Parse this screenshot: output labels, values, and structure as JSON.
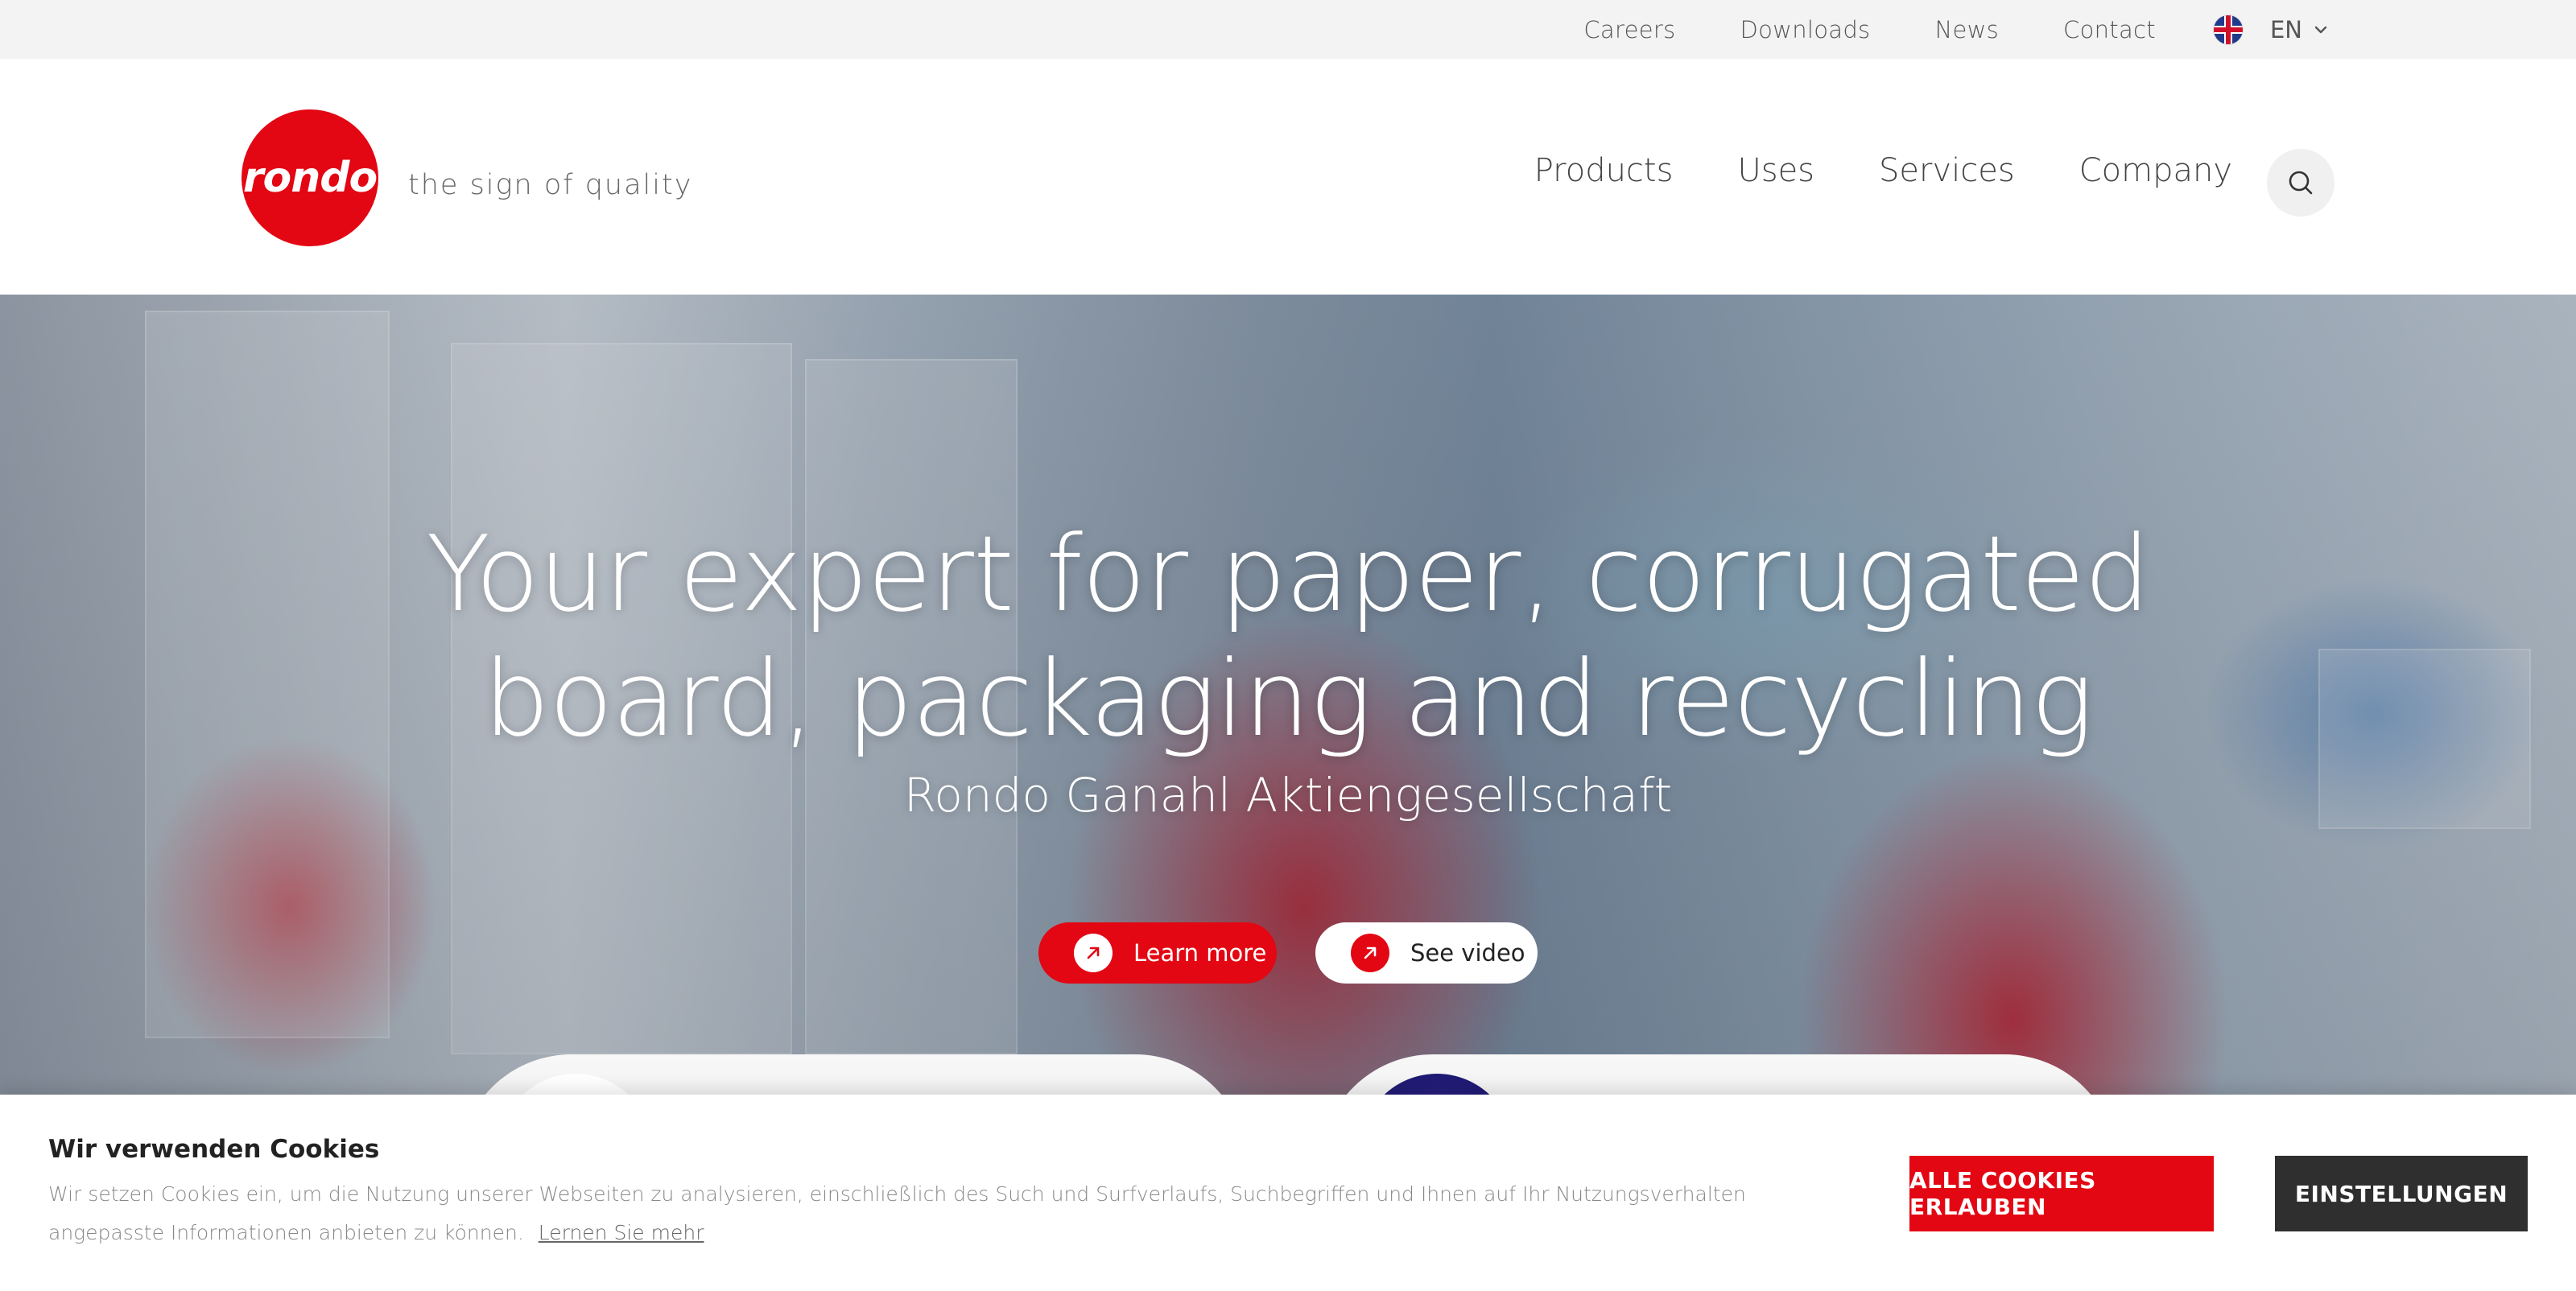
{
  "topbar": {
    "links": [
      "Careers",
      "Downloads",
      "News",
      "Contact"
    ],
    "language": "EN"
  },
  "header": {
    "logo_text": "rondo",
    "tagline": "the sign of quality",
    "nav": [
      "Products",
      "Uses",
      "Services",
      "Company"
    ]
  },
  "hero": {
    "headline_line1": "Your expert for paper, corrugated",
    "headline_line2": "board, packaging and recycling",
    "subline": "Rondo Ganahl Aktiengesellschaft",
    "learn_more": "Learn more",
    "see_video": "See video"
  },
  "cookie": {
    "title": "Wir verwenden Cookies",
    "text": "Wir setzen Cookies ein, um die Nutzung unserer Webseiten zu analysieren, einschließlich des Such und Surfverlaufs, Suchbegriffen und Ihnen auf Ihr Nutzungsverhalten angepasste Informationen anbieten zu können.",
    "learn_link": "Lernen Sie mehr",
    "allow_all": "ALLE COOKIES ERLAUBEN",
    "settings": "EINSTELLUNGEN"
  },
  "colors": {
    "brand_red": "#e30613",
    "dark_button": "#2f2f2f",
    "topbar_bg": "#f3f3f3"
  },
  "icons": [
    "uk-flag-icon",
    "chevron-down-icon",
    "search-icon",
    "arrow-up-right-icon"
  ]
}
